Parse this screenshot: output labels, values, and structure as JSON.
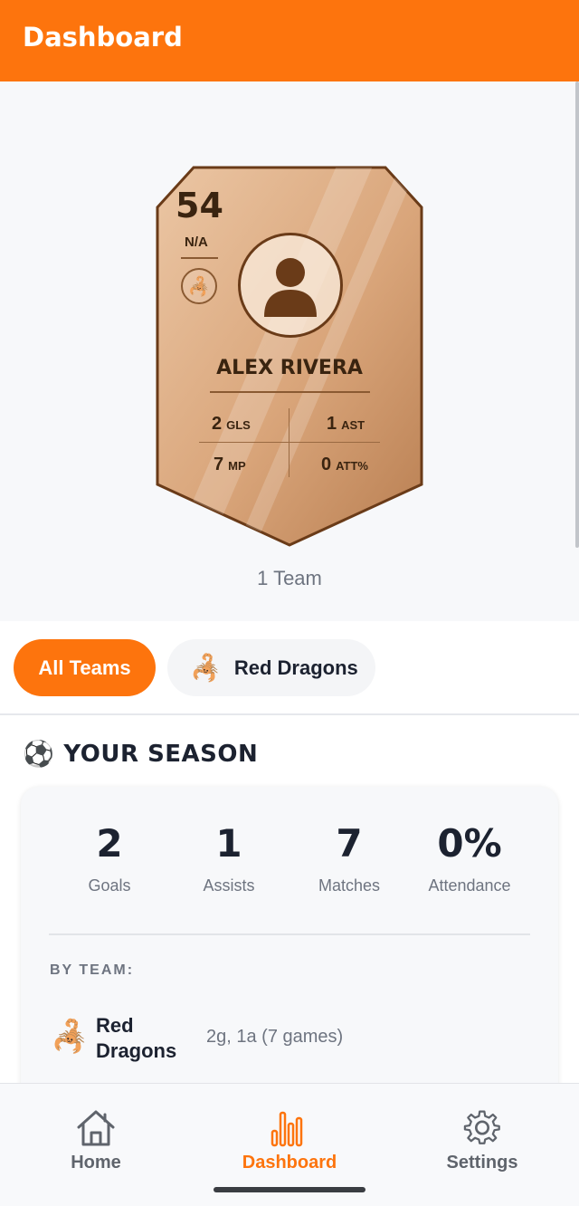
{
  "app_bar": {
    "title": "Dashboard"
  },
  "player_card": {
    "rating": "54",
    "position": "N/A",
    "team_badge_emoji": "🦂",
    "avatar_icon": "person-icon",
    "name": "ALEX RIVERA",
    "stats": [
      {
        "value": "2",
        "label": "GLS"
      },
      {
        "value": "1",
        "label": "AST"
      },
      {
        "value": "7",
        "label": "MP"
      },
      {
        "value": "0",
        "label": "ATT%"
      }
    ],
    "colors": {
      "face_light": "#ebc6a4",
      "face_dark": "#b97f52",
      "border": "#6a3b18"
    }
  },
  "team_count": "1 Team",
  "filters": {
    "all_label": "All Teams",
    "team_label": "Red Dragons",
    "team_emoji": "🦂"
  },
  "season": {
    "icon_emoji": "⚽",
    "title": "YOUR SEASON",
    "stats": [
      {
        "value": "2",
        "label": "Goals"
      },
      {
        "value": "1",
        "label": "Assists"
      },
      {
        "value": "7",
        "label": "Matches"
      },
      {
        "value": "0%",
        "label": "Attendance"
      }
    ],
    "by_team_label": "BY TEAM:",
    "teams": [
      {
        "emoji": "🦂",
        "name": "Red Dragons",
        "summary": "2g, 1a (7 games)"
      }
    ]
  },
  "bottom_nav": {
    "items": [
      {
        "label": "Home",
        "icon": "home-icon",
        "active": false
      },
      {
        "label": "Dashboard",
        "icon": "bar-chart-icon",
        "active": true
      },
      {
        "label": "Settings",
        "icon": "gear-icon",
        "active": false
      }
    ],
    "active_color": "#fd740d",
    "inactive_color": "#5f646c"
  }
}
